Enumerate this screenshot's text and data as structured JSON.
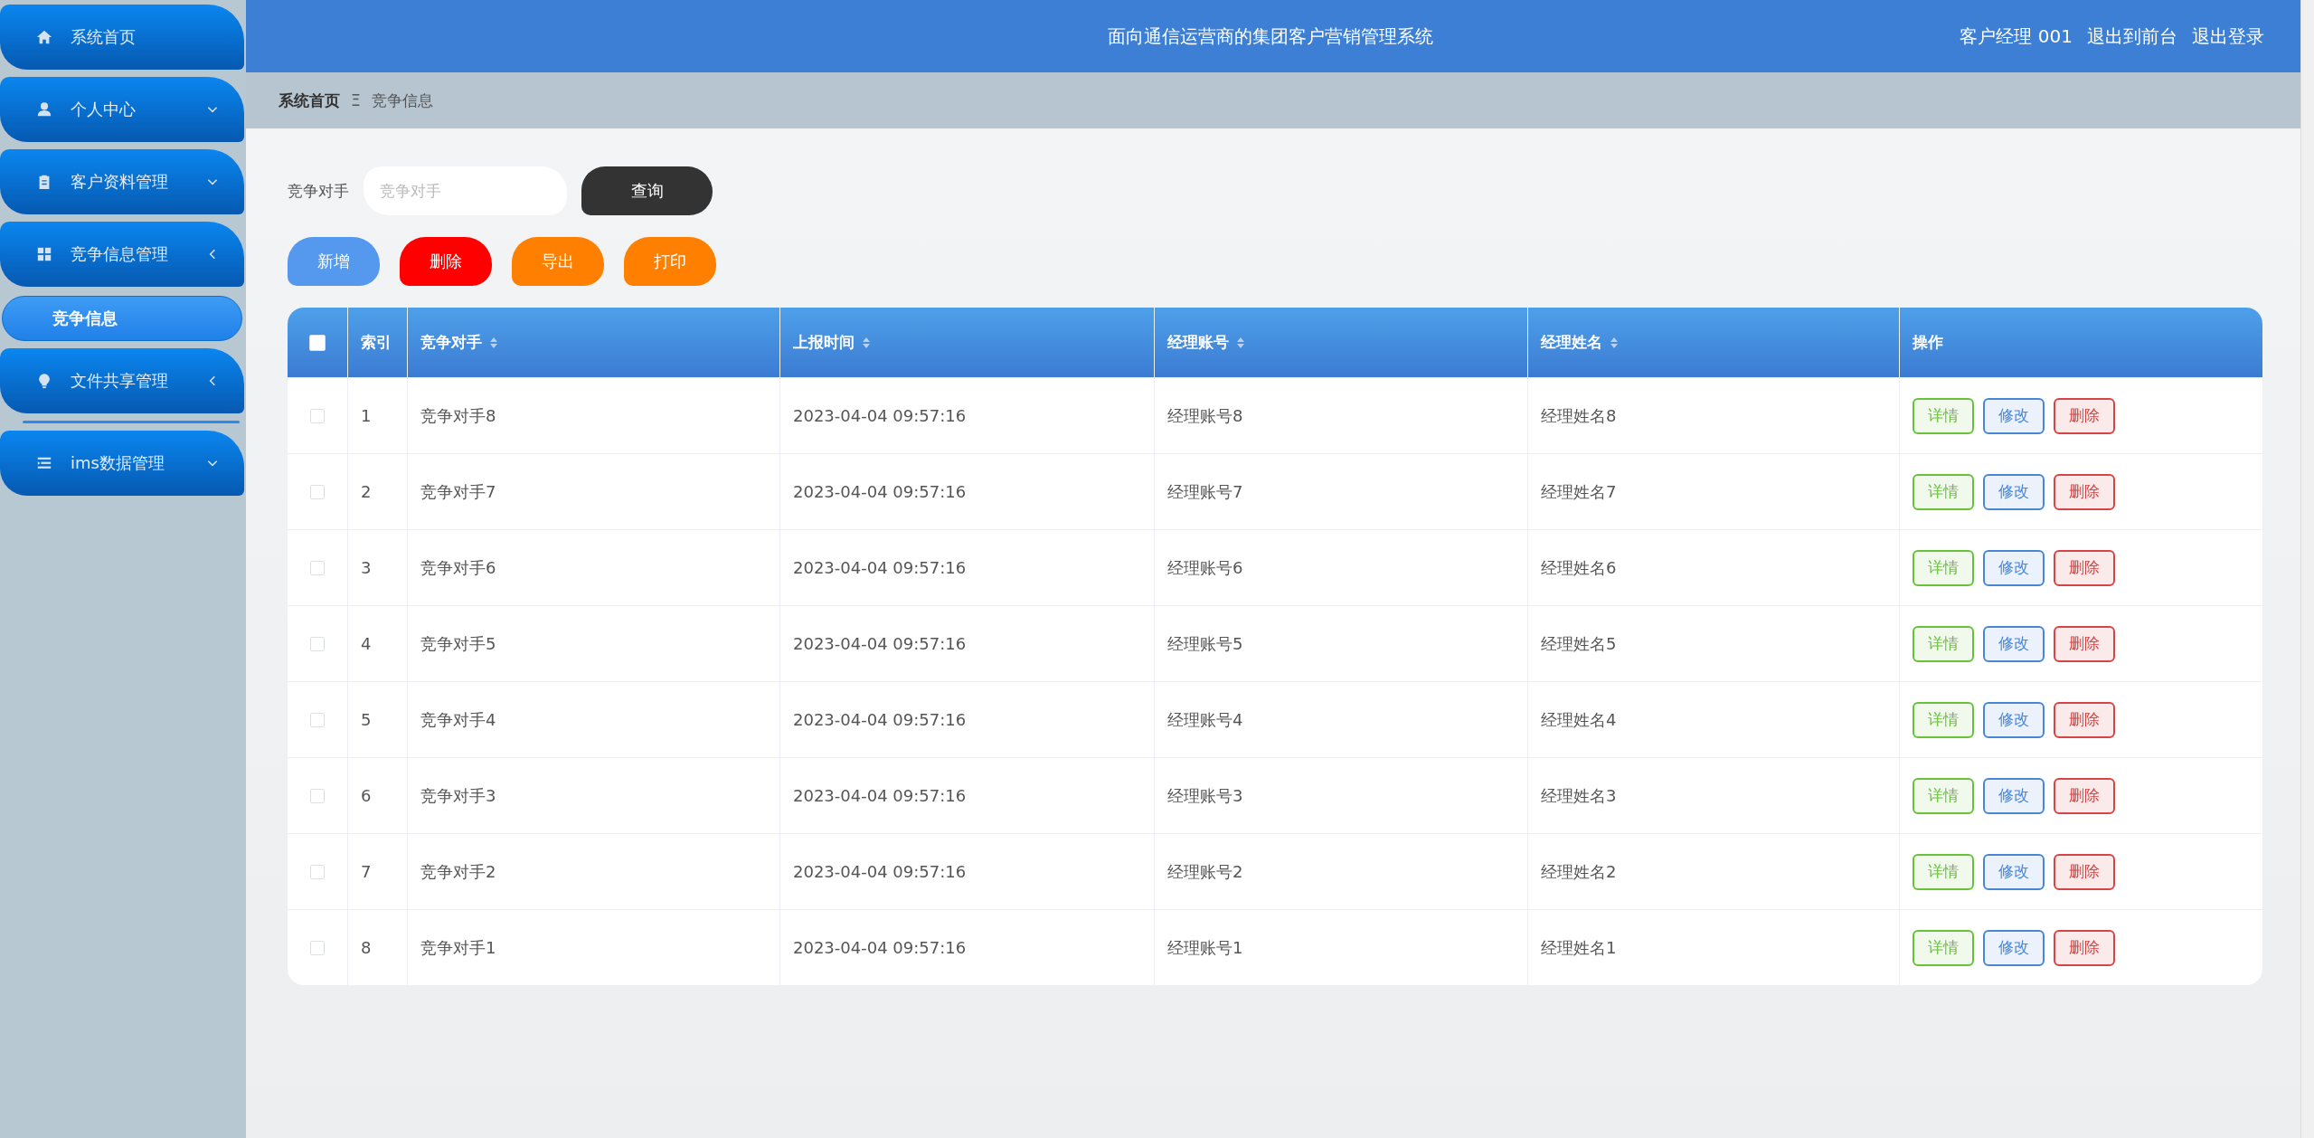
{
  "sidebar": {
    "items": [
      {
        "label": "系统首页",
        "kind": "link"
      },
      {
        "label": "个人中心",
        "kind": "submenu",
        "expanded": false
      },
      {
        "label": "客户资料管理",
        "kind": "submenu",
        "expanded": false
      },
      {
        "label": "竞争信息管理",
        "kind": "submenu",
        "expanded": true,
        "children": [
          {
            "label": "竞争信息",
            "selected": true
          }
        ]
      },
      {
        "label": "文件共享管理",
        "kind": "submenu",
        "expanded": true
      },
      {
        "label": "ims数据管理",
        "kind": "submenu",
        "expanded": false
      }
    ]
  },
  "header": {
    "title": "面向通信运营商的集团客户营销管理系统",
    "user": "客户经理 001",
    "links": [
      "退出到前台",
      "退出登录"
    ]
  },
  "breadcrumb": [
    "系统首页",
    "竞争信息"
  ],
  "breadcrumb_separator": "Ξ",
  "search": {
    "label": "竞争对手",
    "placeholder": "竞争对手",
    "button": "查询"
  },
  "actions": [
    {
      "label": "新增",
      "color": "#5599ee"
    },
    {
      "label": "删除",
      "color": "#ff0000"
    },
    {
      "label": "导出",
      "color": "#ff8000"
    },
    {
      "label": "打印",
      "color": "#ff8000"
    }
  ],
  "table": {
    "select_all_checked": false,
    "columns": [
      {
        "label": "索引",
        "kind": "plain"
      },
      {
        "label": "竞争对手",
        "kind": "sortable"
      },
      {
        "label": "上报时间",
        "kind": "sortable"
      },
      {
        "label": "经理账号",
        "kind": "sortable"
      },
      {
        "label": "经理姓名",
        "kind": "sortable"
      },
      {
        "label": "操作",
        "kind": "plain"
      }
    ],
    "rows": [
      {
        "checked": false,
        "cells": [
          "1",
          "竞争对手8",
          "2023-04-04 09:57:16",
          "经理账号8",
          "经理姓名8"
        ],
        "actions": [
          {
            "label": "详情",
            "kind": "detail"
          },
          {
            "label": "修改",
            "kind": "edit"
          },
          {
            "label": "删除",
            "kind": "delete"
          }
        ]
      },
      {
        "checked": false,
        "cells": [
          "2",
          "竞争对手7",
          "2023-04-04 09:57:16",
          "经理账号7",
          "经理姓名7"
        ],
        "actions": [
          {
            "label": "详情",
            "kind": "detail"
          },
          {
            "label": "修改",
            "kind": "edit"
          },
          {
            "label": "删除",
            "kind": "delete"
          }
        ]
      },
      {
        "checked": false,
        "cells": [
          "3",
          "竞争对手6",
          "2023-04-04 09:57:16",
          "经理账号6",
          "经理姓名6"
        ],
        "actions": [
          {
            "label": "详情",
            "kind": "detail"
          },
          {
            "label": "修改",
            "kind": "edit"
          },
          {
            "label": "删除",
            "kind": "delete"
          }
        ]
      },
      {
        "checked": false,
        "cells": [
          "4",
          "竞争对手5",
          "2023-04-04 09:57:16",
          "经理账号5",
          "经理姓名5"
        ],
        "actions": [
          {
            "label": "详情",
            "kind": "detail"
          },
          {
            "label": "修改",
            "kind": "edit"
          },
          {
            "label": "删除",
            "kind": "delete"
          }
        ]
      },
      {
        "checked": false,
        "cells": [
          "5",
          "竞争对手4",
          "2023-04-04 09:57:16",
          "经理账号4",
          "经理姓名4"
        ],
        "actions": [
          {
            "label": "详情",
            "kind": "detail"
          },
          {
            "label": "修改",
            "kind": "edit"
          },
          {
            "label": "删除",
            "kind": "delete"
          }
        ]
      },
      {
        "checked": false,
        "cells": [
          "6",
          "竞争对手3",
          "2023-04-04 09:57:16",
          "经理账号3",
          "经理姓名3"
        ],
        "actions": [
          {
            "label": "详情",
            "kind": "detail"
          },
          {
            "label": "修改",
            "kind": "edit"
          },
          {
            "label": "删除",
            "kind": "delete"
          }
        ]
      },
      {
        "checked": false,
        "cells": [
          "7",
          "竞争对手2",
          "2023-04-04 09:57:16",
          "经理账号2",
          "经理姓名2"
        ],
        "actions": [
          {
            "label": "详情",
            "kind": "detail"
          },
          {
            "label": "修改",
            "kind": "edit"
          },
          {
            "label": "删除",
            "kind": "delete"
          }
        ]
      },
      {
        "checked": false,
        "cells": [
          "8",
          "竞争对手1",
          "2023-04-04 09:57:16",
          "经理账号1",
          "经理姓名1"
        ],
        "actions": [
          {
            "label": "详情",
            "kind": "detail"
          },
          {
            "label": "修改",
            "kind": "edit"
          },
          {
            "label": "删除",
            "kind": "delete"
          }
        ]
      }
    ]
  }
}
